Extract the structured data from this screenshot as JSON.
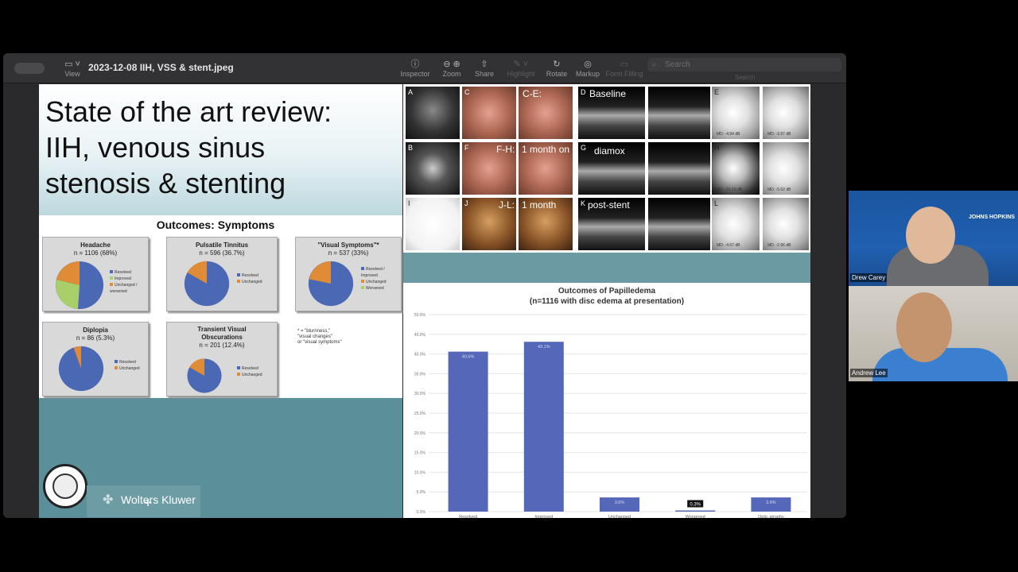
{
  "toolbar": {
    "view_label": "View",
    "document_title": "2023-12-08 IIH, VSS & stent.jpeg",
    "inspector_label": "Inspector",
    "zoom_label": "Zoom",
    "share_label": "Share",
    "highlight_label": "Highlight",
    "rotate_label": "Rotate",
    "markup_label": "Markup",
    "form_filling_label": "Form Filling",
    "search_placeholder": "Search",
    "search_caption": "Search"
  },
  "left_slide": {
    "title_line1": "State of the art review:",
    "title_line2": "IIH, venous sinus",
    "title_line3": "stenosis & stenting",
    "outcomes_title": "Outcomes: Symptoms",
    "pies": [
      {
        "title": "Headache",
        "subtitle": "n = 1106 (68%)",
        "legend": [
          "Resolved",
          "Improved",
          "Unchanged / worsened"
        ]
      },
      {
        "title": "Pulsatile Tinnitus",
        "subtitle": "n = 596 (36.7%)",
        "legend": [
          "Resolved",
          "Unchanged"
        ]
      },
      {
        "title": "\"Visual Symptoms\"*",
        "subtitle": "n = 537 (33%)",
        "legend": [
          "Resolved / Improved",
          "Unchanged",
          "Worsened"
        ]
      },
      {
        "title": "Diplopia",
        "subtitle": "n = 86 (5.3%)",
        "legend": [
          "Resolved",
          "Unchanged"
        ]
      },
      {
        "title": "Transient Visual Obscurations",
        "subtitle": "n = 201 (12.4%)",
        "legend": [
          "Resolved",
          "Unchanged"
        ]
      }
    ],
    "footnote_line1": "* = \"blurriness,\"",
    "footnote_line2": "\"visual changes\"",
    "footnote_line3": "or \"visual symptoms\"",
    "publisher": "Wolters Kluwer"
  },
  "right_slide": {
    "figure_labels": {
      "a": "A",
      "b": "B",
      "c": "C",
      "d": "D",
      "e": "E",
      "f": "F",
      "g": "G",
      "h": "H",
      "i": "I",
      "j": "J",
      "k": "K",
      "l": "L",
      "ce": "C-E:",
      "baseline": "Baseline",
      "fh": "F-H:",
      "one_month_on": "1 month on",
      "diamox": "diamox",
      "jl": "J-L:",
      "one_month": "1 month",
      "post_stent": "post-stent"
    },
    "vf_md": [
      "MD: -4.94 dB",
      "MD: -3.97 dB",
      "MD: -15.15 dB",
      "MD: -5.52 dB",
      "MD: -4.67 dB",
      "MD: -2.96 dB"
    ]
  },
  "chart_data": {
    "type": "bar",
    "title": "Outcomes of Papilledema",
    "subtitle": "(n=1116 with disc edema at presentation)",
    "categories": [
      "Resolved",
      "Improved",
      "Unchanged",
      "Worsened",
      "Optic atrophy"
    ],
    "values": [
      40.6,
      43.1,
      3.6,
      0.3,
      3.6
    ],
    "data_labels": [
      "40.6%",
      "43.1%",
      "3.6%",
      "0.3%",
      "3.6%"
    ],
    "ylim": [
      0,
      50
    ],
    "yticks": [
      "0.0%",
      "5.0%",
      "10.0%",
      "15.0%",
      "20.0%",
      "25.0%",
      "30.0%",
      "35.0%",
      "40.0%",
      "45.0%",
      "50.0%"
    ],
    "bar_color": "#5567b8",
    "grid": true
  },
  "participants": [
    {
      "name": "Drew Carey",
      "org": "JOHNS HOPKINS"
    },
    {
      "name": "Andrew Lee"
    }
  ]
}
